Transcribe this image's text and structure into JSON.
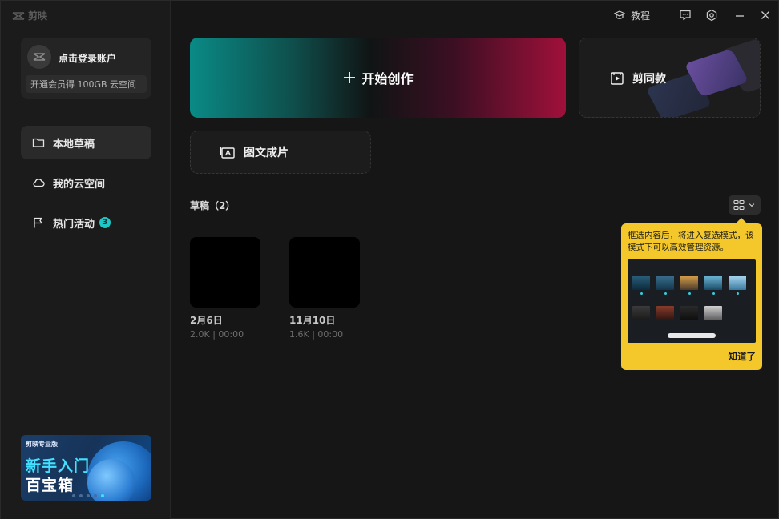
{
  "app": {
    "brand": "剪映"
  },
  "titlebar": {
    "tutorial_label": "教程",
    "buttons": [
      "feedback-icon",
      "settings-icon",
      "minimize-icon",
      "close-icon"
    ]
  },
  "sidebar": {
    "account": {
      "login_text": "点击登录账户",
      "vip_text": "开通会员得 100GB 云空间"
    },
    "items": [
      {
        "label": "本地草稿",
        "icon": "folder-icon",
        "active": true
      },
      {
        "label": "我的云空间",
        "icon": "cloud-icon",
        "active": false
      },
      {
        "label": "热门活动",
        "icon": "flag-icon",
        "badge": "3",
        "active": false
      }
    ],
    "promo": {
      "small": "剪映专业版",
      "line1": "新手入门",
      "line2": "百宝箱"
    }
  },
  "main": {
    "create_label": "开始创作",
    "template_label": "剪同款",
    "imgtext_label": "图文成片",
    "drafts": {
      "title": "草稿（2）",
      "items": [
        {
          "name": "2月6日",
          "meta": "2.0K | 00:00"
        },
        {
          "name": "11月10日",
          "meta": "1.6K | 00:00"
        }
      ]
    }
  },
  "tooltip": {
    "text": "框选内容后，将进入复选模式，该模式下可以高效管理资源。",
    "confirm": "知道了"
  },
  "colors": {
    "accent_teal": "#0a8a86",
    "accent_red": "#a0103b",
    "tooltip_bg": "#f4c82a",
    "badge": "#1fc6c6"
  }
}
